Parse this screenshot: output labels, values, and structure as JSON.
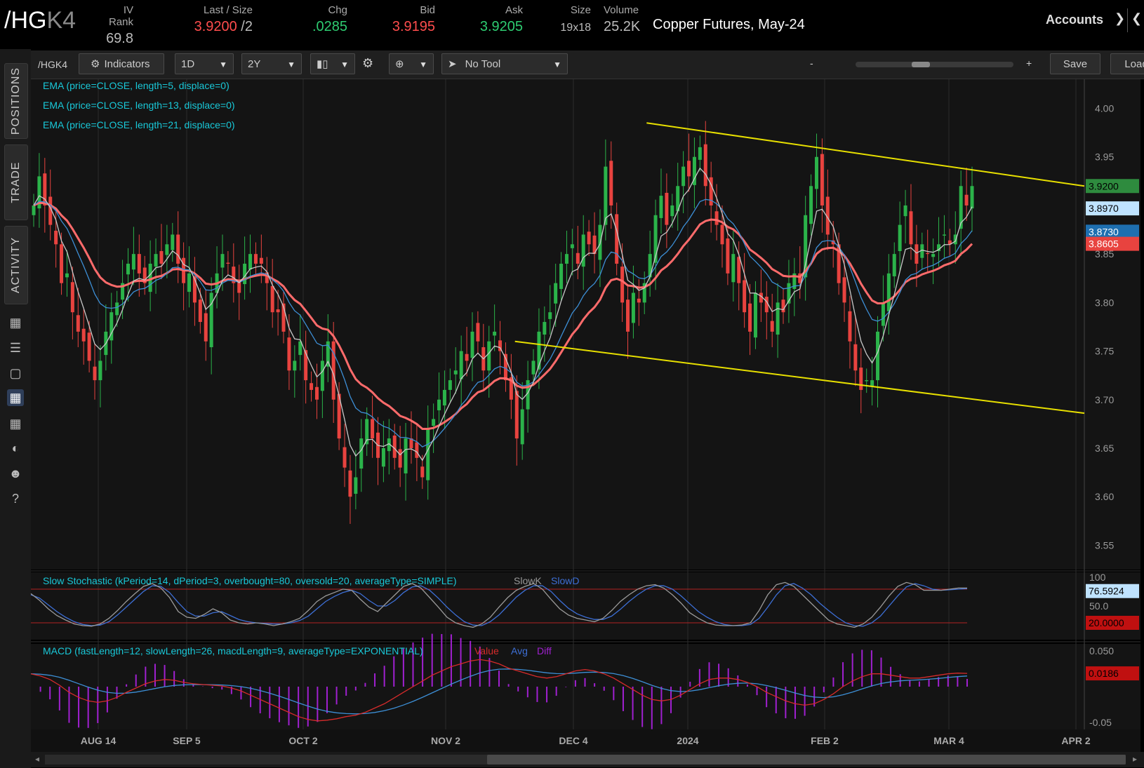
{
  "header": {
    "symbol_main": "/HG",
    "symbol_suffix": "K4",
    "quotes": [
      {
        "label": "IV Rank",
        "value": "69.8",
        "color": "#bbbbbb"
      },
      {
        "label": "Last / Size",
        "value": "3.9200",
        "value2": " /2",
        "color": "#ff4d4d"
      },
      {
        "label": "Chg",
        "value": ".0285",
        "color": "#2ecc71"
      },
      {
        "label": "Bid",
        "value": "3.9195",
        "color": "#ff4d4d"
      },
      {
        "label": "Ask",
        "value": "3.9205",
        "color": "#2ecc71"
      },
      {
        "label": "Size",
        "value": "19x18",
        "color": "#bbbbbb"
      },
      {
        "label": "Volume",
        "value": "25.2K",
        "color": "#bbbbbb"
      }
    ],
    "description": "Copper Futures, May-24",
    "accounts_label": "Accounts"
  },
  "sidebar": {
    "tabs": [
      "POSITIONS",
      "TRADE",
      "ACTIVITY"
    ],
    "icons": [
      "monitor-icon",
      "list-icon",
      "tv-icon",
      "chart-icon",
      "grid-icon",
      "gauge-icon",
      "people-icon",
      "help-icon"
    ]
  },
  "toolbar": {
    "symbol": "/HGK4",
    "indicators_label": "Indicators",
    "interval": "1D",
    "range": "2Y",
    "tool_label": "No Tool",
    "zoom_minus": "-",
    "zoom_plus": "+",
    "save_label": "Save",
    "load_label": "Load"
  },
  "chart_data": {
    "type": "candlestick",
    "title": "",
    "studies": [
      "EMA (price=CLOSE, length=5, displace=0)",
      "EMA (price=CLOSE, length=13, displace=0)",
      "EMA (price=CLOSE, length=21, displace=0)"
    ],
    "x_labels": [
      "AUG 14",
      "SEP 5",
      "OCT 2",
      "NOV 2",
      "DEC 4",
      "2024",
      "FEB 2",
      "MAR 4",
      "APR 2"
    ],
    "y_ticks": [
      "4.00",
      "3.95",
      "3.90",
      "3.85",
      "3.80",
      "3.75",
      "3.70",
      "3.65",
      "3.60",
      "3.55"
    ],
    "ylim": [
      3.525,
      4.03
    ],
    "last_price_labels": [
      {
        "text": "3.9200",
        "value": 3.92,
        "bg": "#2e8b3e",
        "fg": "#000000"
      },
      {
        "text": "3.8970",
        "value": 3.897,
        "bg": "#bfe3ff",
        "fg": "#000000"
      },
      {
        "text": "3.8730",
        "value": 3.873,
        "bg": "#1e6fb0",
        "fg": "#ffffff"
      },
      {
        "text": "3.8605",
        "value": 3.8605,
        "bg": "#e8433f",
        "fg": "#ffffff"
      }
    ],
    "ema_close_series": [
      3.9,
      3.93,
      3.9,
      3.88,
      3.86,
      3.82,
      3.83,
      3.79,
      3.77,
      3.76,
      3.74,
      3.72,
      3.74,
      3.77,
      3.79,
      3.8,
      3.82,
      3.84,
      3.85,
      3.83,
      3.82,
      3.84,
      3.85,
      3.84,
      3.86,
      3.87,
      3.84,
      3.82,
      3.83,
      3.8,
      3.78,
      3.76,
      3.81,
      3.83,
      3.85,
      3.84,
      3.82,
      3.81,
      3.84,
      3.85,
      3.84,
      3.84,
      3.82,
      3.79,
      3.79,
      3.77,
      3.73,
      3.74,
      3.76,
      3.72,
      3.71,
      3.7,
      3.74,
      3.76,
      3.7,
      3.66,
      3.63,
      3.6,
      3.62,
      3.66,
      3.68,
      3.66,
      3.64,
      3.65,
      3.66,
      3.64,
      3.63,
      3.66,
      3.65,
      3.64,
      3.62,
      3.67,
      3.68,
      3.7,
      3.71,
      3.72,
      3.73,
      3.75,
      3.74,
      3.77,
      3.76,
      3.73,
      3.76,
      3.77,
      3.75,
      3.72,
      3.7,
      3.66,
      3.69,
      3.72,
      3.74,
      3.77,
      3.78,
      3.79,
      3.82,
      3.84,
      3.85,
      3.86,
      3.84,
      3.87,
      3.86,
      3.85,
      3.88,
      3.94,
      3.9,
      3.84,
      3.8,
      3.77,
      3.81,
      3.8,
      3.82,
      3.85,
      3.89,
      3.91,
      3.88,
      3.9,
      3.92,
      3.94,
      3.93,
      3.95,
      3.96,
      3.92,
      3.9,
      3.88,
      3.86,
      3.83,
      3.85,
      3.82,
      3.79,
      3.77,
      3.81,
      3.8,
      3.79,
      3.77,
      3.8,
      3.79,
      3.82,
      3.83,
      3.82,
      3.89,
      3.92,
      3.95,
      3.9,
      3.87,
      3.86,
      3.82,
      3.8,
      3.76,
      3.73,
      3.71,
      3.72,
      3.72,
      3.77,
      3.8,
      3.83,
      3.85,
      3.88,
      3.9,
      3.86,
      3.84,
      3.86,
      3.85,
      3.85,
      3.86,
      3.87,
      3.86,
      3.87,
      3.92,
      3.9,
      3.92
    ],
    "ema_fast_label_price": 3.897,
    "channel_lines": [
      {
        "from": [
          0.5845,
          3.985
        ],
        "to": [
          1.0,
          3.92
        ]
      },
      {
        "from": [
          0.4595,
          3.76
        ],
        "to": [
          1.0,
          3.686
        ]
      }
    ],
    "colors": {
      "up": "#2bb34a",
      "down": "#e8433f",
      "ema5": "#c8c8c8",
      "ema13": "#3d8fd6",
      "ema21": "#ff6b6b",
      "channel": "#e8e000",
      "grid": "#2c2c2c"
    },
    "stochastic": {
      "label": "Slow Stochastic (kPeriod=14, dPeriod=3, overbought=80, oversold=20, averageType=SIMPLE)",
      "legend_k": "SlowK",
      "legend_d": "SlowD",
      "y_ticks": [
        "100",
        "50.0"
      ],
      "value_label": "76.5924",
      "oversold_label": "20.0000",
      "overbought": 80,
      "oversold": 20,
      "k": [
        72,
        60,
        45,
        33,
        25,
        18,
        15,
        14,
        18,
        28,
        42,
        58,
        72,
        85,
        90,
        82,
        65,
        40,
        30,
        28,
        35,
        45,
        38,
        25,
        20,
        18,
        20,
        18,
        15,
        18,
        22,
        28,
        42,
        58,
        68,
        74,
        80,
        78,
        62,
        48,
        40,
        55,
        70,
        85,
        90,
        82,
        65,
        48,
        30,
        20,
        15,
        12,
        18,
        30,
        48,
        65,
        78,
        85,
        90,
        80,
        62,
        45,
        34,
        28,
        25,
        22,
        28,
        42,
        58,
        70,
        80,
        86,
        88,
        82,
        70,
        55,
        38,
        28,
        20,
        16,
        15,
        15,
        16,
        20,
        42,
        70,
        88,
        92,
        85,
        70,
        55,
        40,
        25,
        18,
        15,
        12,
        18,
        30,
        48,
        68,
        85,
        92,
        88,
        78,
        78,
        78,
        80,
        82,
        82
      ],
      "d": [
        70,
        64,
        52,
        40,
        30,
        22,
        17,
        15,
        16,
        22,
        34,
        48,
        62,
        76,
        86,
        85,
        74,
        56,
        40,
        32,
        32,
        38,
        40,
        33,
        26,
        22,
        20,
        19,
        18,
        18,
        20,
        24,
        32,
        45,
        58,
        67,
        74,
        78,
        72,
        60,
        50,
        50,
        60,
        74,
        84,
        86,
        78,
        64,
        48,
        34,
        22,
        16,
        15,
        22,
        34,
        50,
        66,
        78,
        86,
        86,
        76,
        60,
        46,
        36,
        30,
        26,
        26,
        32,
        44,
        58,
        70,
        80,
        86,
        86,
        80,
        68,
        54,
        40,
        30,
        22,
        17,
        15,
        15,
        17,
        28,
        48,
        70,
        86,
        90,
        82,
        70,
        55,
        42,
        30,
        20,
        15,
        14,
        20,
        32,
        50,
        68,
        84,
        90,
        86,
        80,
        78,
        79,
        80,
        81
      ]
    },
    "macd": {
      "label": "MACD (fastLength=12, slowLength=26, macdLength=9, averageType=EXPONENTIAL)",
      "legend_value": "Value",
      "legend_avg": "Avg",
      "legend_diff": "Diff",
      "y_ticks": [
        "0.050",
        "-0.05"
      ],
      "value_label": "0.0186",
      "value": [
        0.018,
        0.015,
        0.01,
        0.002,
        -0.008,
        -0.015,
        -0.02,
        -0.022,
        -0.02,
        -0.015,
        -0.008,
        -0.002,
        0.004,
        0.008,
        0.01,
        0.009,
        0.006,
        0.004,
        0.003,
        0.002,
        0.001,
        -0.002,
        -0.006,
        -0.012,
        -0.018,
        -0.024,
        -0.03,
        -0.036,
        -0.042,
        -0.046,
        -0.048,
        -0.047,
        -0.045,
        -0.042,
        -0.04,
        -0.036,
        -0.03,
        -0.024,
        -0.016,
        -0.008,
        0.0,
        0.008,
        0.016,
        0.022,
        0.028,
        0.032,
        0.036,
        0.038,
        0.036,
        0.032,
        0.026,
        0.022,
        0.018,
        0.014,
        0.012,
        0.014,
        0.018,
        0.022,
        0.024,
        0.022,
        0.018,
        0.012,
        0.004,
        -0.004,
        -0.012,
        -0.018,
        -0.02,
        -0.018,
        -0.012,
        -0.004,
        0.004,
        0.01,
        0.012,
        0.012,
        0.01,
        0.006,
        0.0,
        -0.008,
        -0.014,
        -0.02,
        -0.024,
        -0.026,
        -0.024,
        -0.018,
        -0.01,
        0.0,
        0.008,
        0.014,
        0.018,
        0.018,
        0.016,
        0.014,
        0.012,
        0.012,
        0.014,
        0.016,
        0.018,
        0.019,
        0.0186
      ]
    }
  }
}
